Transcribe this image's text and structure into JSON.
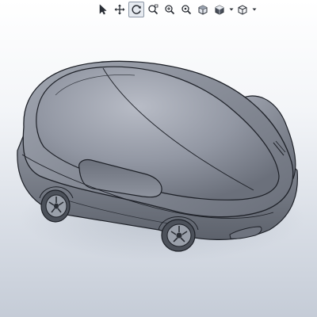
{
  "viewport": {
    "background_top": "#ffffff",
    "background_bottom": "#c5ccd7"
  },
  "view_toolbar": {
    "buttons": [
      {
        "name": "select-cursor-icon",
        "active": false
      },
      {
        "name": "pan-move-icon",
        "active": false
      },
      {
        "name": "rotate-view-icon",
        "active": true
      },
      {
        "name": "zoom-to-area-icon",
        "active": false
      },
      {
        "name": "zoom-in-out-icon",
        "active": false
      },
      {
        "name": "zoom-to-fit-icon",
        "active": false
      },
      {
        "name": "standard-views-cube-icon",
        "active": false
      },
      {
        "name": "display-style-icon",
        "active": false
      },
      {
        "name": "view-orientation-icon",
        "active": false
      }
    ]
  },
  "model": {
    "name": "concept-car-body",
    "body_color": "#8b909c",
    "edge_color": "#1e2128"
  }
}
